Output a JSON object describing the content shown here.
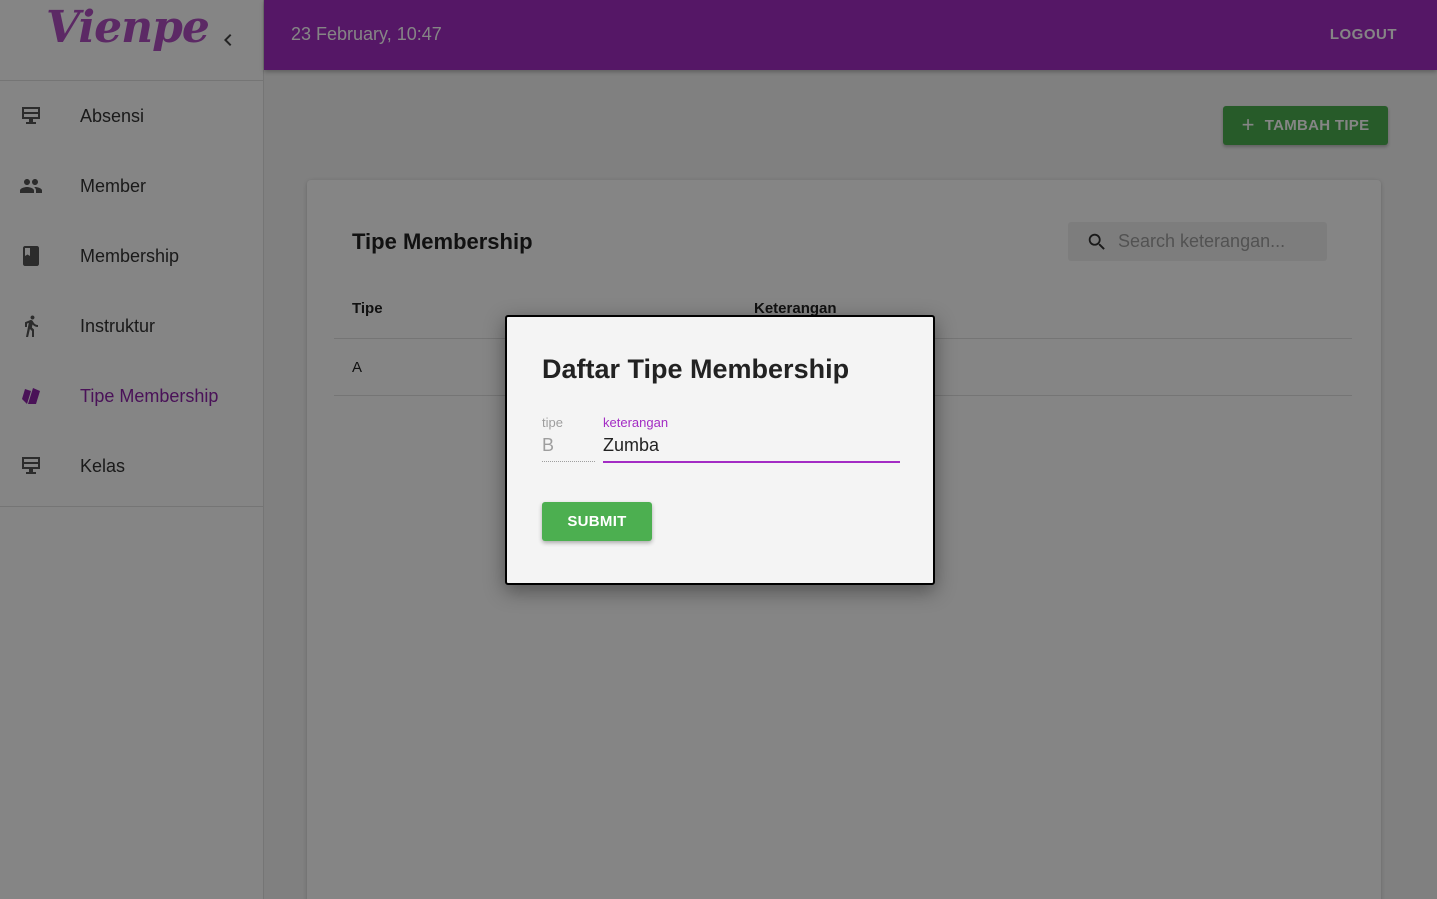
{
  "brand": {
    "logo_text": "Vienpe"
  },
  "header": {
    "datetime": "23 February,  10:47",
    "logout_label": "LOGOUT"
  },
  "sidebar": {
    "items": [
      {
        "label": "Absensi",
        "icon": "monitor-icon"
      },
      {
        "label": "Member",
        "icon": "people-icon"
      },
      {
        "label": "Membership",
        "icon": "book-icon"
      },
      {
        "label": "Instruktur",
        "icon": "running-icon"
      },
      {
        "label": "Tipe Membership",
        "icon": "cards-icon",
        "active": true
      },
      {
        "label": "Kelas",
        "icon": "monitor-icon"
      }
    ]
  },
  "main": {
    "add_button_label": "TAMBAH TIPE",
    "card_title": "Tipe Membership",
    "search": {
      "placeholder": "Search keterangan..."
    },
    "table": {
      "columns": [
        "Tipe",
        "Keterangan"
      ],
      "rows": [
        {
          "tipe": "A",
          "keterangan": ""
        }
      ]
    }
  },
  "dialog": {
    "title": "Daftar Tipe Membership",
    "tipe_label": "tipe",
    "tipe_value": "B",
    "keterangan_label": "keterangan",
    "keterangan_value": "Zumba",
    "submit_label": "SUBMIT"
  },
  "colors": {
    "primary": "#a32cc4",
    "success": "#4caf50",
    "active_nav": "#8e24aa"
  }
}
